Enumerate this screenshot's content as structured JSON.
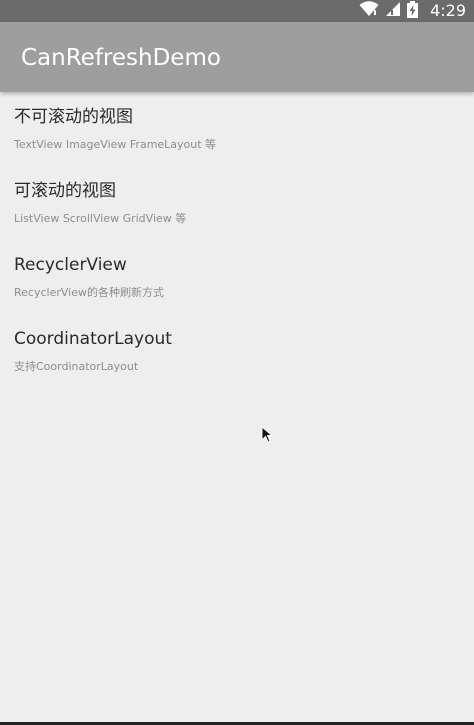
{
  "status_bar": {
    "time": "4:29",
    "icons": [
      "wifi-icon",
      "cellular-signal-icon",
      "battery-charging-icon"
    ]
  },
  "app_bar": {
    "title": "CanRefreshDemo"
  },
  "list": {
    "items": [
      {
        "title": "不可滚动的视图",
        "subtitle": "TextView ImageView FrameLayout 等"
      },
      {
        "title": "可滚动的视图",
        "subtitle": "ListView ScrollView GridView 等"
      },
      {
        "title": "RecyclerView",
        "subtitle": "RecyclerView的各种刷新方式"
      },
      {
        "title": "CoordinatorLayout",
        "subtitle": "支持CoordinatorLayout"
      }
    ]
  },
  "colors": {
    "status_bar": "#6b6b6b",
    "app_bar": "#9e9e9e",
    "background": "#eeeeee",
    "title_text": "#2a2a2a",
    "subtitle_text": "#8d8d8d"
  }
}
